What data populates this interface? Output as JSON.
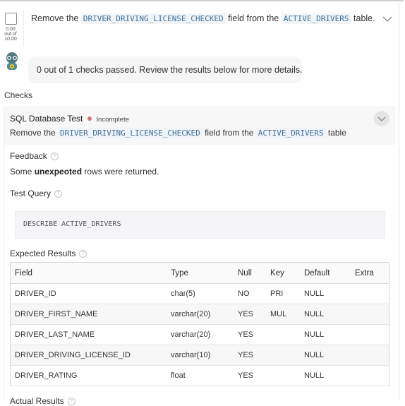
{
  "task": {
    "score": "0.00",
    "score_out_of_label": "out of",
    "score_max": "10.00",
    "text_prefix": "Remove the",
    "field_code": "DRIVER_DRIVING_LICENSE_CHECKED",
    "text_middle": "field from the",
    "table_code": "ACTIVE_DRIVERS",
    "text_suffix": "table."
  },
  "assistant": {
    "message": "0 out of 1 checks passed. Review the results below for more details."
  },
  "checks_label": "Checks",
  "check": {
    "title": "SQL Database Test",
    "status": "Incomplete",
    "status_color": "#d9737a",
    "desc_prefix": "Remove the",
    "desc_field": "DRIVER_DRIVING_LICENSE_CHECKED",
    "desc_middle": "field from the",
    "desc_table": "ACTIVE_DRIVERS",
    "desc_suffix": "table",
    "feedback_label": "Feedback",
    "feedback_prefix": "Some",
    "feedback_bold": "unexpeoted",
    "feedback_suffix": "rows were returned.",
    "test_query_label": "Test Query",
    "query": "DESCRIBE ACTIVE_DRIVERS",
    "expected_label": "Expected Results",
    "actual_label": "Actual Results",
    "help_glyph": "?"
  },
  "expected_results": {
    "columns": [
      "Field",
      "Type",
      "Null",
      "Key",
      "Default",
      "Extra"
    ],
    "rows": [
      [
        "DRIVER_ID",
        "char(5)",
        "NO",
        "PRI",
        "NULL",
        ""
      ],
      [
        "DRIVER_FIRST_NAME",
        "varchar(20)",
        "YES",
        "MUL",
        "NULL",
        ""
      ],
      [
        "DRIVER_LAST_NAME",
        "varchar(20)",
        "YES",
        "",
        "NULL",
        ""
      ],
      [
        "DRIVER_DRIVING_LICENSE_ID",
        "varchar(10)",
        "YES",
        "",
        "NULL",
        ""
      ],
      [
        "DRIVER_RATING",
        "float",
        "YES",
        "",
        "NULL",
        ""
      ]
    ]
  }
}
